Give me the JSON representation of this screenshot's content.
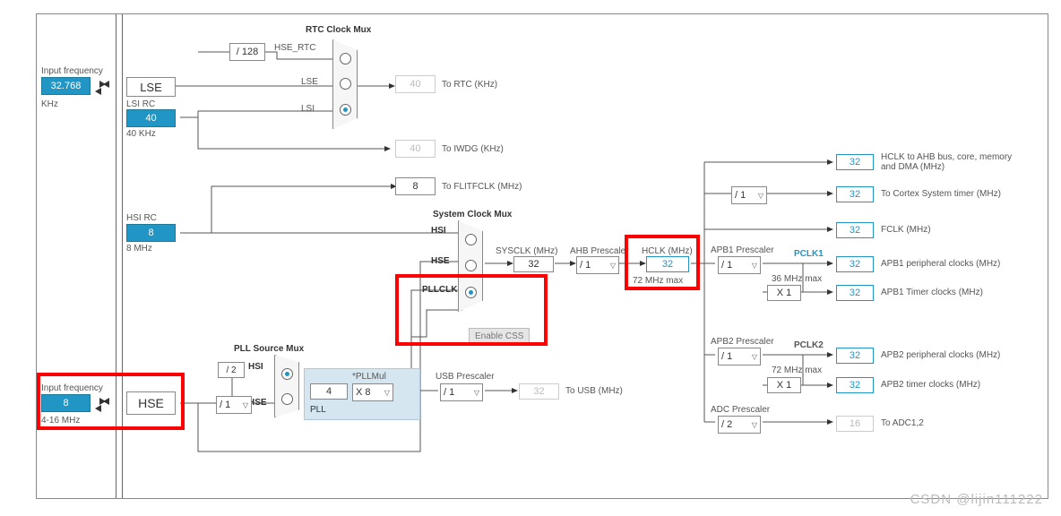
{
  "watermark": "CSDN @lijin111222",
  "lse": {
    "input_freq_label": "Input frequency",
    "value": "32.768",
    "unit": "KHz",
    "name": "LSE"
  },
  "lsi": {
    "name": "LSI RC",
    "value": "40",
    "unit": "40 KHz"
  },
  "hsi": {
    "name": "HSI RC",
    "value": "8",
    "unit": "8 MHz"
  },
  "hse": {
    "input_freq_label": "Input frequency",
    "value": "8",
    "range": "4-16 MHz",
    "name": "HSE"
  },
  "rtc_mux": {
    "title": "RTC Clock Mux",
    "hse_div": "/ 128",
    "hse_rtc": "HSE_RTC",
    "lse": "LSE",
    "lsi": "LSI",
    "out_val": "40",
    "out_label": "To RTC (KHz)"
  },
  "iwdg": {
    "val": "40",
    "label": "To IWDG (KHz)"
  },
  "flitclk": {
    "val": "8",
    "label": "To FLITFCLK (MHz)"
  },
  "pll_src": {
    "title": "PLL Source Mux",
    "hsi": "HSI",
    "hse": "HSE",
    "hsi_div": "/ 2",
    "hse_div": "/ 1"
  },
  "pll": {
    "mul_label": "*PLLMul",
    "value": "4",
    "mul": "X 8",
    "name": "PLL"
  },
  "sysclk_mux": {
    "title": "System Clock Mux",
    "hsi": "HSI",
    "hse": "HSE",
    "pllclk": "PLLCLK",
    "enable_css": "Enable CSS"
  },
  "sysclk": {
    "label": "SYSCLK (MHz)",
    "val": "32"
  },
  "ahb": {
    "label": "AHB Prescaler",
    "val": "/ 1"
  },
  "hclk": {
    "label": "HCLK (MHz)",
    "val": "32",
    "max": "72 MHz max"
  },
  "usb": {
    "label": "USB Prescaler",
    "val": "/ 1",
    "out_val": "32",
    "out_label": "To USB (MHz)"
  },
  "apb1": {
    "label": "APB1 Prescaler",
    "val": "/ 1",
    "pclk": "PCLK1",
    "max": "36 MHz max",
    "timer_mul": "X 1"
  },
  "apb2": {
    "label": "APB2 Prescaler",
    "val": "/ 1",
    "pclk": "PCLK2",
    "max": "72 MHz max",
    "timer_mul": "X 1"
  },
  "adc": {
    "label": "ADC Prescaler",
    "val": "/ 2"
  },
  "cortex_div": "/ 1",
  "outputs": {
    "ahb": {
      "val": "32",
      "label": "HCLK to AHB bus, core, memory and DMA (MHz)"
    },
    "cortex": {
      "val": "32",
      "label": "To Cortex System timer (MHz)"
    },
    "fclk": {
      "val": "32",
      "label": "FCLK (MHz)"
    },
    "apb1_periph": {
      "val": "32",
      "label": "APB1 peripheral clocks (MHz)"
    },
    "apb1_timer": {
      "val": "32",
      "label": "APB1 Timer clocks (MHz)"
    },
    "apb2_periph": {
      "val": "32",
      "label": "APB2 peripheral clocks (MHz)"
    },
    "apb2_timer": {
      "val": "32",
      "label": "APB2 timer clocks (MHz)"
    },
    "adc": {
      "val": "16",
      "label": "To ADC1,2"
    }
  }
}
